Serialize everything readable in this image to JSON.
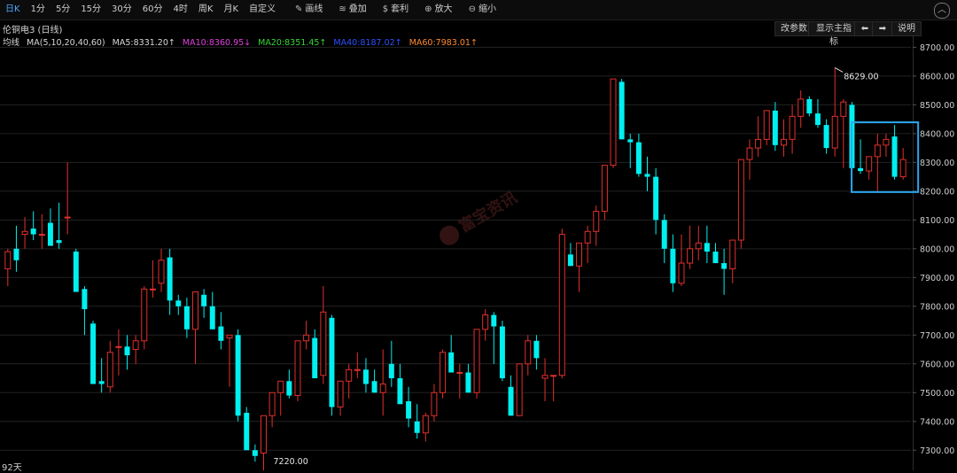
{
  "toolbar": {
    "periods": [
      "日K",
      "1分",
      "5分",
      "15分",
      "30分",
      "60分",
      "4时",
      "周K",
      "月K",
      "自定义"
    ],
    "active_period": "日K",
    "tools": [
      {
        "icon": "pencil-icon",
        "glyph": "✎",
        "label": "画线"
      },
      {
        "icon": "layers-icon",
        "glyph": "≋",
        "label": "叠加"
      },
      {
        "icon": "money-bag-icon",
        "glyph": "$",
        "label": "套利"
      },
      {
        "icon": "zoom-in-icon",
        "glyph": "⊕",
        "label": "放大"
      },
      {
        "icon": "zoom-out-icon",
        "glyph": "⊖",
        "label": "缩小"
      }
    ],
    "more_icon": "chevron-up-icon"
  },
  "chart": {
    "title": "伦铜电3 (日线)",
    "ma_label": "均线",
    "ma_params": "MA(5,10,20,40,60)",
    "ma_values": [
      {
        "text": "MA5:8331.20↑",
        "color": "#d8d8d8"
      },
      {
        "text": "MA10:8360.95↓",
        "color": "#e040e0"
      },
      {
        "text": "MA20:8351.45↑",
        "color": "#36d636"
      },
      {
        "text": "MA40:8187.02↑",
        "color": "#3050ff"
      },
      {
        "text": "MA60:7983.01↑",
        "color": "#ff8a30"
      }
    ],
    "buttons": {
      "params": "改参数",
      "main_indicator": "显示主指标",
      "prev": "⬅",
      "next": "➡",
      "help": "说明"
    },
    "days": "92天",
    "watermark": "富宝资讯",
    "high_label": "8629.00",
    "low_label": "7220.00"
  },
  "chart_data": {
    "type": "candlestick",
    "y_ticks": [
      "8700.00",
      "8600.00",
      "8500.00",
      "8400.00",
      "8300.00",
      "8200.00",
      "8100.00",
      "8000.00",
      "7900.00",
      "7800.00",
      "7700.00",
      "7600.00",
      "7500.00",
      "7400.00",
      "7300.00"
    ],
    "ylim": [
      7230,
      8735
    ],
    "candles": [
      [
        7930,
        8000,
        7870,
        7990
      ],
      [
        8000,
        8080,
        7920,
        7960
      ],
      [
        8050,
        8110,
        8000,
        8060
      ],
      [
        8070,
        8130,
        8030,
        8050
      ],
      [
        8050,
        8120,
        8000,
        8050
      ],
      [
        8090,
        8140,
        8030,
        8010
      ],
      [
        8030,
        8160,
        8000,
        8020
      ],
      [
        8110,
        8300,
        8050,
        8110
      ],
      [
        7990,
        8000,
        7860,
        7850
      ],
      [
        7860,
        7870,
        7700,
        7790
      ],
      [
        7740,
        7750,
        7530,
        7530
      ],
      [
        7540,
        7620,
        7500,
        7530
      ],
      [
        7520,
        7680,
        7500,
        7640
      ],
      [
        7660,
        7720,
        7560,
        7660
      ],
      [
        7660,
        7700,
        7580,
        7630
      ],
      [
        7650,
        7700,
        7600,
        7680
      ],
      [
        7680,
        7870,
        7650,
        7860
      ],
      [
        7860,
        7960,
        7830,
        7860
      ],
      [
        7880,
        8000,
        7850,
        7960
      ],
      [
        7970,
        8000,
        7770,
        7820
      ],
      [
        7820,
        7840,
        7770,
        7800
      ],
      [
        7800,
        7830,
        7690,
        7720
      ],
      [
        7720,
        7800,
        7600,
        7850
      ],
      [
        7840,
        7860,
        7760,
        7800
      ],
      [
        7800,
        7850,
        7750,
        7720
      ],
      [
        7730,
        7780,
        7650,
        7680
      ],
      [
        7690,
        7700,
        7520,
        7700
      ],
      [
        7700,
        7720,
        7400,
        7420
      ],
      [
        7430,
        7450,
        7340,
        7300
      ],
      [
        7300,
        7320,
        7260,
        7280
      ],
      [
        7290,
        7360,
        7220,
        7420
      ],
      [
        7420,
        7500,
        7380,
        7500
      ],
      [
        7500,
        7530,
        7420,
        7540
      ],
      [
        7540,
        7580,
        7480,
        7490
      ],
      [
        7490,
        7650,
        7470,
        7680
      ],
      [
        7680,
        7750,
        7650,
        7700
      ],
      [
        7690,
        7720,
        7550,
        7550
      ],
      [
        7560,
        7870,
        7530,
        7780
      ],
      [
        7760,
        7770,
        7420,
        7450
      ],
      [
        7450,
        7500,
        7420,
        7540
      ],
      [
        7540,
        7600,
        7480,
        7580
      ],
      [
        7580,
        7640,
        7550,
        7580
      ],
      [
        7580,
        7620,
        7500,
        7530
      ],
      [
        7540,
        7580,
        7500,
        7500
      ],
      [
        7500,
        7650,
        7420,
        7530
      ],
      [
        7600,
        7680,
        7520,
        7550
      ],
      [
        7550,
        7600,
        7480,
        7460
      ],
      [
        7470,
        7520,
        7380,
        7410
      ],
      [
        7400,
        7460,
        7340,
        7360
      ],
      [
        7360,
        7430,
        7330,
        7420
      ],
      [
        7420,
        7530,
        7400,
        7500
      ],
      [
        7500,
        7650,
        7480,
        7640
      ],
      [
        7640,
        7700,
        7580,
        7570
      ],
      [
        7570,
        7600,
        7480,
        7570
      ],
      [
        7570,
        7600,
        7500,
        7500
      ],
      [
        7500,
        7620,
        7480,
        7720
      ],
      [
        7720,
        7790,
        7680,
        7770
      ],
      [
        7770,
        7780,
        7600,
        7730
      ],
      [
        7730,
        7750,
        7540,
        7550
      ],
      [
        7520,
        7560,
        7420,
        7420
      ],
      [
        7420,
        7500,
        7420,
        7600
      ],
      [
        7600,
        7700,
        7560,
        7680
      ],
      [
        7680,
        7700,
        7580,
        7620
      ],
      [
        7550,
        7620,
        7470,
        7560
      ],
      [
        7560,
        7560,
        7470,
        7560
      ],
      [
        7560,
        8070,
        7550,
        8050
      ],
      [
        7980,
        8020,
        7950,
        7940
      ],
      [
        7940,
        8000,
        7850,
        8020
      ],
      [
        8020,
        8080,
        7950,
        8060
      ],
      [
        8060,
        8150,
        8010,
        8130
      ],
      [
        8130,
        8250,
        8100,
        8290
      ],
      [
        8290,
        8580,
        8280,
        8590
      ],
      [
        8580,
        8590,
        8380,
        8380
      ],
      [
        8380,
        8400,
        8280,
        8370
      ],
      [
        8370,
        8400,
        8250,
        8260
      ],
      [
        8260,
        8320,
        8200,
        8250
      ],
      [
        8250,
        8280,
        8050,
        8100
      ],
      [
        8100,
        8120,
        7950,
        8000
      ],
      [
        8000,
        8050,
        7850,
        7880
      ],
      [
        7880,
        8050,
        7870,
        7950
      ],
      [
        7950,
        8080,
        7930,
        8000
      ],
      [
        8000,
        8080,
        7960,
        8020
      ],
      [
        8020,
        8080,
        7950,
        7990
      ],
      [
        7990,
        8020,
        7950,
        7950
      ],
      [
        7950,
        8000,
        7840,
        7930
      ],
      [
        7930,
        8030,
        7880,
        8030
      ],
      [
        8030,
        8220,
        8000,
        8310
      ],
      [
        8310,
        8380,
        8240,
        8350
      ],
      [
        8350,
        8460,
        8320,
        8380
      ],
      [
        8380,
        8480,
        8360,
        8480
      ],
      [
        8480,
        8510,
        8340,
        8360
      ],
      [
        8360,
        8450,
        8320,
        8380
      ],
      [
        8380,
        8500,
        8330,
        8460
      ],
      [
        8460,
        8550,
        8420,
        8520
      ],
      [
        8520,
        8530,
        8460,
        8470
      ],
      [
        8470,
        8520,
        8420,
        8430
      ],
      [
        8430,
        8450,
        8330,
        8350
      ],
      [
        8350,
        8629,
        8320,
        8460
      ],
      [
        8460,
        8520,
        8280,
        8510
      ],
      [
        8500,
        8510,
        8280,
        8280
      ],
      [
        8280,
        8380,
        8260,
        8270
      ],
      [
        8270,
        8310,
        8240,
        8320
      ],
      [
        8320,
        8400,
        8200,
        8360
      ],
      [
        8360,
        8400,
        8320,
        8380
      ],
      [
        8390,
        8430,
        8240,
        8250
      ],
      [
        8250,
        8350,
        8240,
        8310
      ]
    ],
    "highlight": {
      "from_index": 100,
      "to_index": 105,
      "color": "#2aa8f0"
    }
  },
  "colors": {
    "up": "#e0302c",
    "down": "#00f0f0",
    "grid": "#222",
    "text": "#cfcfcf",
    "accent": "#4aa8ff"
  }
}
